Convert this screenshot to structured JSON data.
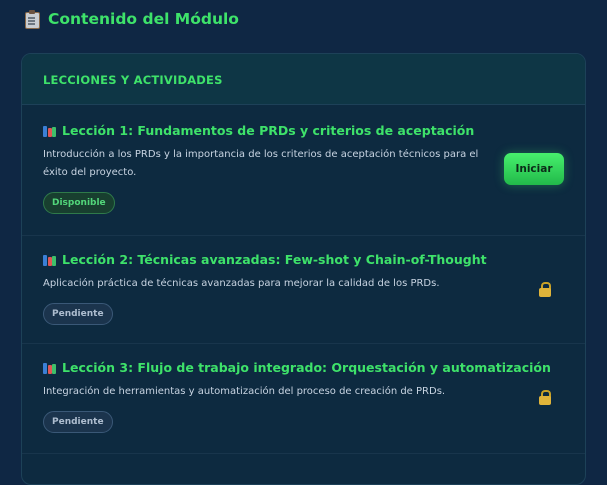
{
  "page": {
    "title": "Contenido del Módulo",
    "title_icon": "clipboard-icon"
  },
  "section": {
    "header": "LECCIONES Y ACTIVIDADES"
  },
  "lessons": [
    {
      "icon": "books-icon",
      "title": "Lección 1: Fundamentos de PRDs y criterios de aceptación",
      "description": "Introducción a los PRDs y la importancia de los criterios de aceptación técnicos para el éxito del proyecto.",
      "status": "Disponible",
      "action_label": "Iniciar"
    },
    {
      "icon": "books-icon",
      "title": "Lección 2: Técnicas avanzadas: Few-shot y Chain-of-Thought",
      "description": "Aplicación práctica de técnicas avanzadas para mejorar la calidad de los PRDs.",
      "status": "Pendiente",
      "locked_icon": "lock-icon"
    },
    {
      "icon": "books-icon",
      "title": "Lección 3: Flujo de trabajo integrado: Orquestación y automatización",
      "description": "Integración de herramientas y automatización del proceso de creación de PRDs.",
      "status": "Pendiente",
      "locked_icon": "lock-icon"
    }
  ],
  "colors": {
    "background": "#0f2744",
    "accent": "#3ee26a",
    "lock": "#e0b43a"
  }
}
